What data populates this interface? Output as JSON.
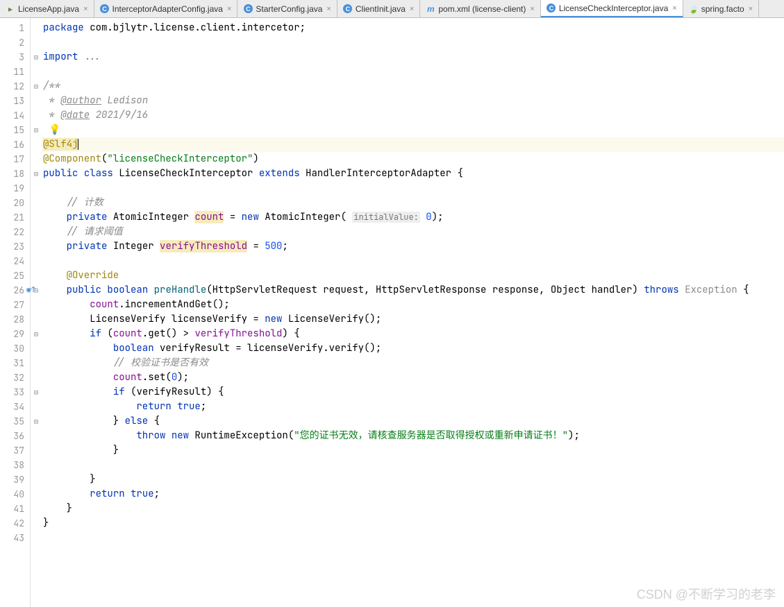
{
  "tabs": [
    {
      "icon": "java",
      "label": "LicenseApp.java",
      "active": false
    },
    {
      "icon": "class",
      "label": "InterceptorAdapterConfig.java",
      "active": false
    },
    {
      "icon": "class",
      "label": "StarterConfig.java",
      "active": false
    },
    {
      "icon": "class",
      "label": "ClientInit.java",
      "active": false
    },
    {
      "icon": "maven",
      "label": "pom.xml (license-client)",
      "active": false
    },
    {
      "icon": "class",
      "label": "LicenseCheckInterceptor.java",
      "active": true
    },
    {
      "icon": "spring",
      "label": "spring.facto",
      "active": false
    }
  ],
  "lineNumbers": [
    "1",
    "2",
    "3",
    "11",
    "12",
    "13",
    "14",
    "15",
    "16",
    "17",
    "18",
    "19",
    "20",
    "21",
    "22",
    "23",
    "24",
    "25",
    "26",
    "27",
    "28",
    "29",
    "30",
    "31",
    "32",
    "33",
    "34",
    "35",
    "36",
    "37",
    "38",
    "39",
    "40",
    "41",
    "42",
    "43"
  ],
  "foldMarkers": [
    "",
    "",
    "⊟",
    "",
    "⊟",
    "",
    "",
    "⊟",
    "",
    "",
    "⊟",
    "",
    "",
    "",
    "",
    "",
    "",
    "",
    "⊟",
    "",
    "",
    "⊟",
    "",
    "",
    "",
    "⊟",
    "",
    "⊟",
    "",
    "",
    "",
    "",
    "",
    "",
    "",
    ""
  ],
  "code": {
    "pkg_kw": "package",
    "pkg_name": " com.bjlytr.license.client.intercetor;",
    "import_kw": "import",
    "import_ellipsis": " ...",
    "doc_open": "/**",
    "doc_author_star": " * ",
    "doc_author_tag": "@author",
    "doc_author_val": " Ledison",
    "doc_date_tag": "@date",
    "doc_date_val": " 2021/9/16",
    "anno_slf4j": "@Slf4j",
    "anno_component": "@Component",
    "anno_component_val": "\"licenseCheckInterceptor\"",
    "public_kw": "public",
    "class_kw": "class",
    "class_name": "LicenseCheckInterceptor",
    "extends_kw": "extends",
    "super_class": "HandlerInterceptorAdapter",
    "cmt_count": "// 计数",
    "private_kw": "private",
    "type_atomic": "AtomicInteger",
    "field_count": "count",
    "new_kw": "new",
    "hint_initval": "initialValue:",
    "val_zero": "0",
    "cmt_threshold": "// 请求阈值",
    "type_integer": "Integer",
    "field_threshold": "verifyThreshold",
    "val_500": "500",
    "anno_override": "@Override",
    "boolean_kw": "boolean",
    "method_prehandle": "preHandle",
    "sig_rest": "(HttpServletRequest request, HttpServletResponse response, Object handler) ",
    "throws_kw": "throws",
    "exc_type": "Exception",
    "incr_call": ".incrementAndGet();",
    "type_lv": "LicenseVerify",
    "var_lv": "licenseVerify",
    "lv_ctor": "LicenseVerify();",
    "if_kw": "if",
    "get_call": ".get() > ",
    "var_result": "verifyResult",
    "verify_call": ".verify();",
    "cmt_verify": "// 校验证书是否有效",
    "set_call": ".set(",
    "return_kw": "return",
    "true_kw": "true",
    "else_kw": "else",
    "throw_kw": "throw",
    "rte_type": "RuntimeException",
    "err_msg": "\"您的证书无效，请核查服务器是否取得授权或重新申请证书！\""
  },
  "watermark": "CSDN @不断学习的老李"
}
